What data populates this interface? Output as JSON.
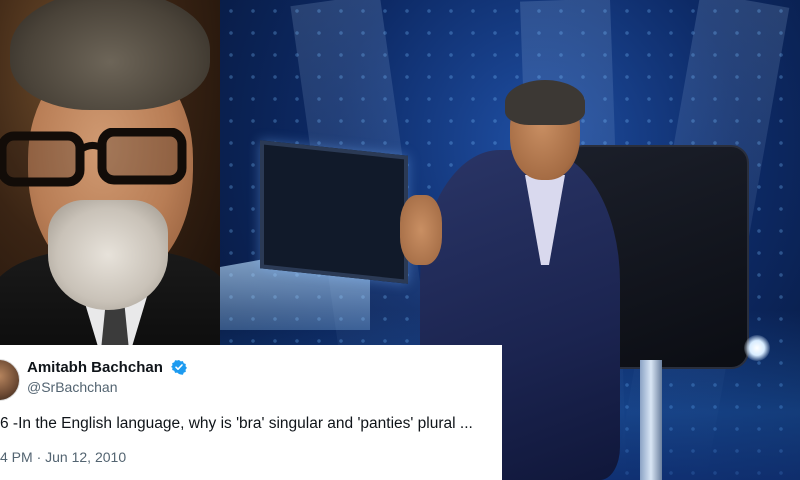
{
  "tweet": {
    "author_name": "Amitabh Bachchan",
    "handle": "@SrBachchan",
    "text": "6 -In the English language, why is 'bra' singular and 'panties' plural ...",
    "time": "4 PM",
    "separator": "·",
    "date": "Jun 12, 2010",
    "verified": true
  },
  "colors": {
    "verified_badge": "#1d9bf0",
    "studio_blue": "#0d2a66",
    "text_primary": "#0f1419",
    "text_secondary": "#536471"
  }
}
